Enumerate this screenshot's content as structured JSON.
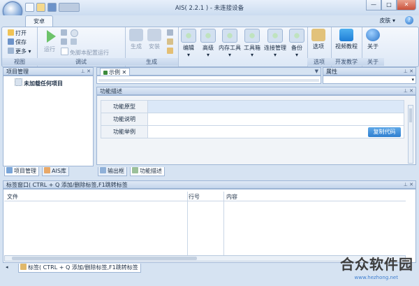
{
  "window": {
    "title": "AIS( 2.2.1 ) - 未连接设备",
    "min_label": "—",
    "max_label": "□",
    "close_label": "✕"
  },
  "ribbon_tabs": {
    "active": "安卓",
    "skin": "皮肤",
    "skin_caret": "▾",
    "help": "?"
  },
  "ribbon": {
    "view": {
      "label": "视图",
      "open": "打开",
      "save": "保存",
      "more": "更多"
    },
    "debug": {
      "label": "调试",
      "run": "运行",
      "no_config_run": "免脚本配置运行"
    },
    "generate": {
      "label": "生成",
      "build": "生成",
      "install": "安装"
    },
    "tools": {
      "edit": "编辑",
      "advanced": "高级",
      "memtools": "内存工具",
      "toolbox": "工具箱",
      "connmgr": "连接管理",
      "backup": "备份"
    },
    "options": {
      "label": "选项",
      "btn": "选项"
    },
    "devteach": {
      "label": "开发教学",
      "btn": "视频教程"
    },
    "about": {
      "label": "关于",
      "btn": "关于"
    }
  },
  "project_panel": {
    "title": "项目管理",
    "tree_item": "未加载任何项目",
    "tab_project": "项目管理",
    "tab_ais": "AIS库"
  },
  "doc_tab": {
    "label": "示例",
    "close": "✕",
    "dropdown": "▼"
  },
  "properties_panel": {
    "title": "属性"
  },
  "func_panel": {
    "title": "功能描述",
    "rows": [
      {
        "key": "功能原型",
        "value": ""
      },
      {
        "key": "功能说明",
        "value": ""
      },
      {
        "key": "功能举例",
        "value": ""
      }
    ],
    "copy_btn": "复制代码",
    "tab_output": "输出框",
    "tab_func": "功能描述"
  },
  "tag_panel": {
    "title": "标签窗口( CTRL + Q 添加/删除标签,F1跳转标签",
    "columns": [
      "文件",
      "行号",
      "内容"
    ],
    "bottom_tab": "标签( CTRL + Q 添加/删除标签,F1跳转标签"
  },
  "watermark": {
    "text": "合众软件园",
    "url": "www.hezhong.net"
  },
  "colors": {
    "accent": "#2f7fd0",
    "ribbon_bg": "#dde8f6",
    "panel_hdr": "#c4d5ec"
  }
}
